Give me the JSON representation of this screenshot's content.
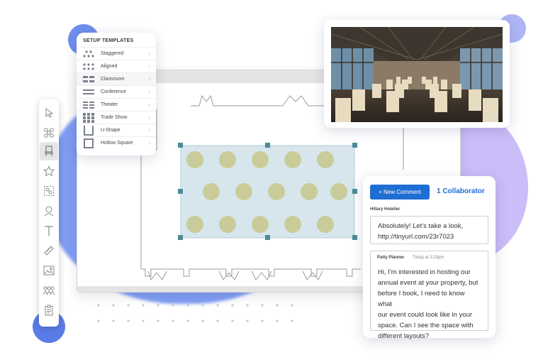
{
  "templates": {
    "title": "SETUP TEMPLATES",
    "items": [
      {
        "label": "Staggered",
        "icon": "staggered-icon"
      },
      {
        "label": "Aligned",
        "icon": "aligned-icon"
      },
      {
        "label": "Classroom",
        "icon": "classroom-icon"
      },
      {
        "label": "Conference",
        "icon": "conference-icon"
      },
      {
        "label": "Theater",
        "icon": "theater-icon"
      },
      {
        "label": "Trade Show",
        "icon": "trade-show-icon"
      },
      {
        "label": "U-Shape",
        "icon": "u-shape-icon"
      },
      {
        "label": "Hollow Square",
        "icon": "hollow-square-icon"
      }
    ]
  },
  "toolbar": {
    "tools": [
      "select-arrow-icon",
      "table-group-icon",
      "chair-icon",
      "star-icon",
      "group-icon",
      "location-pin-icon",
      "text-icon",
      "ruler-icon",
      "image-icon",
      "people-icon",
      "clipboard-icon"
    ],
    "active": "chair-icon"
  },
  "comments": {
    "new_button": "+ New Comment",
    "collaborators": "1 Collaborator",
    "reply_author": "Hillary Hotelier",
    "reply_text_1": "Absolutely! Let's take a look,",
    "reply_text_2": "http://tinyurl.com/23r7023",
    "thread_author": "Patty Planner",
    "thread_time": "Today at 3:20pm",
    "thread_lines": [
      "Hi, I'm interested in hosting our",
      "annual event at your property, but",
      "before I book, I need to know what",
      "our event could look like in your",
      "space. Can I see the space with",
      "different layouts?"
    ]
  },
  "colors": {
    "accent": "#1f6ed4",
    "blob_blue": "#7d9bf2",
    "blob_purple": "#c6b7f7",
    "table": "#c8cc97",
    "selection": "#d3e4ea",
    "handle": "#4d8b95"
  }
}
